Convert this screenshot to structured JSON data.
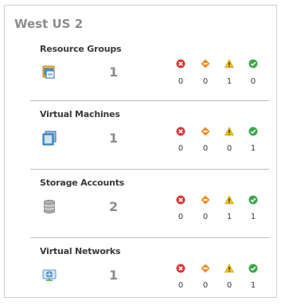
{
  "region": {
    "title": "West US 2"
  },
  "resources": [
    {
      "title": "Resource Groups",
      "icon": "resource-group-icon",
      "count": "1",
      "status": {
        "error": "0",
        "critical": "0",
        "warning": "1",
        "ok": "0"
      }
    },
    {
      "title": "Virtual Machines",
      "icon": "virtual-machine-icon",
      "count": "1",
      "status": {
        "error": "0",
        "critical": "0",
        "warning": "0",
        "ok": "1"
      }
    },
    {
      "title": "Storage Accounts",
      "icon": "storage-account-icon",
      "count": "2",
      "status": {
        "error": "0",
        "critical": "0",
        "warning": "1",
        "ok": "1"
      }
    },
    {
      "title": "Virtual Networks",
      "icon": "virtual-network-icon",
      "count": "1",
      "status": {
        "error": "0",
        "critical": "0",
        "warning": "0",
        "ok": "1"
      }
    }
  ],
  "colors": {
    "error": "#d9383a",
    "critical": "#f08a1c",
    "warning": "#f2c200",
    "ok": "#3aa84a",
    "title_gray": "#8c8c8c"
  }
}
